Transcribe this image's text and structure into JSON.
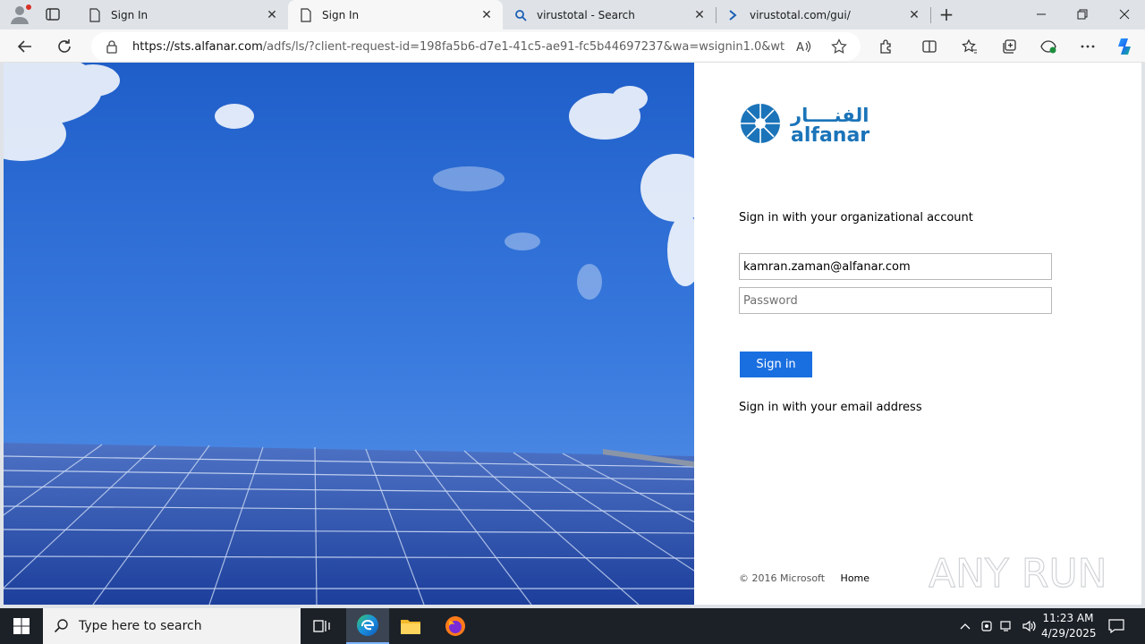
{
  "browser": {
    "tabs": [
      {
        "title": "Sign In",
        "icon": "page-icon",
        "active": false
      },
      {
        "title": "Sign In",
        "icon": "page-icon",
        "active": true
      },
      {
        "title": "virustotal - Search",
        "icon": "search-icon",
        "active": false
      },
      {
        "title": "virustotal.com/gui/",
        "icon": "virustotal-icon",
        "active": false
      }
    ],
    "url_host": "https://sts.alfanar.com",
    "url_path": "/adfs/ls/?client-request-id=198fa5b6-d7e1-41c5-ae91-fc5b44697237&wa=wsignin1.0&wtreal..."
  },
  "signin": {
    "logo_arabic": "الفنــــار",
    "logo_latin": "alfanar",
    "title": "Sign in with your organizational account",
    "username_value": "kamran.zaman@alfanar.com",
    "password_placeholder": "Password",
    "button_label": "Sign in",
    "email_link": "Sign in with your email address",
    "copyright": "© 2016 Microsoft",
    "home_link": "Home"
  },
  "watermark": {
    "text": "ANY RUN"
  },
  "taskbar": {
    "search_placeholder": "Type here to search",
    "time": "11:23 AM",
    "date": "4/29/2025"
  },
  "colors": {
    "accent": "#1a6fe0",
    "logo_blue": "#1b74b9",
    "sky": "#2f6ed6"
  }
}
